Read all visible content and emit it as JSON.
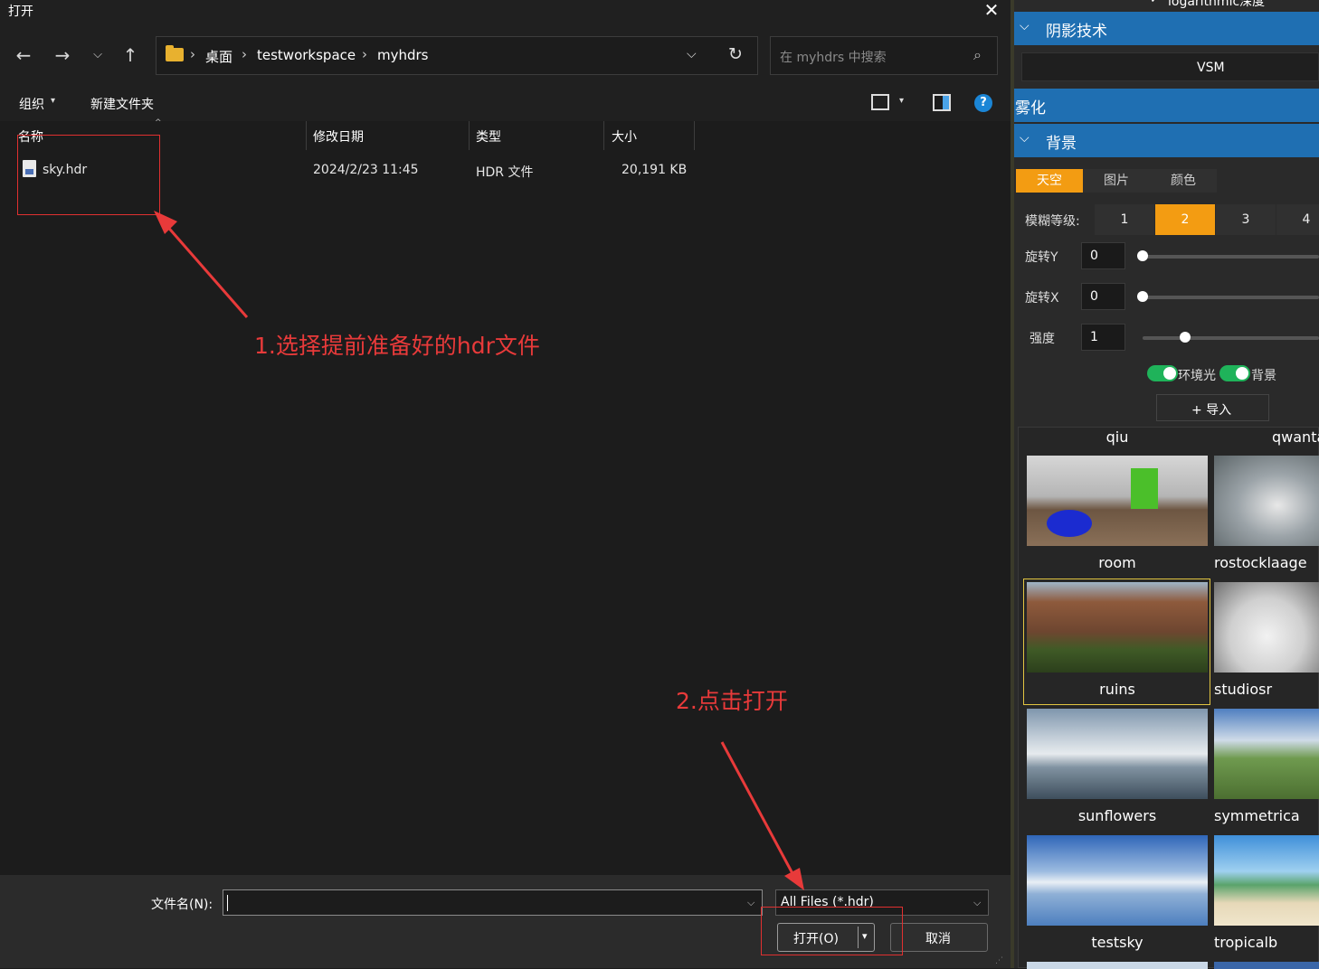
{
  "dialog": {
    "title": "打开",
    "breadcrumb": [
      "桌面",
      "testworkspace",
      "myhdrs"
    ],
    "search_placeholder": "在 myhdrs 中搜索",
    "toolbar": {
      "organize": "组织",
      "new_folder": "新建文件夹"
    },
    "columns": {
      "name": "名称",
      "modified": "修改日期",
      "type": "类型",
      "size": "大小"
    },
    "files": [
      {
        "name": "sky.hdr",
        "modified": "2024/2/23 11:45",
        "type": "HDR 文件",
        "size": "20,191 KB"
      }
    ],
    "filename_label": "文件名(N):",
    "filename_value": "",
    "filter": "All Files (*.hdr)",
    "open_label": "打开(O)",
    "cancel_label": "取消"
  },
  "annotations": {
    "step1": "1.选择提前准备好的hdr文件",
    "step2": "2.点击打开",
    "color": "#e83a3a"
  },
  "panel": {
    "top_cut": "logarithmic深度",
    "shadow_section": "阴影技术",
    "shadow_value": "VSM",
    "fog_section": "雾化",
    "background_section": "背景",
    "bg_tabs": [
      "天空",
      "图片",
      "颜色"
    ],
    "bg_tab_active": "天空",
    "blur_label": "模糊等级:",
    "blur_levels": [
      "1",
      "2",
      "3",
      "4"
    ],
    "blur_active": "2",
    "rotate_y_label": "旋转Y",
    "rotate_y_value": "0",
    "rotate_x_label": "旋转X",
    "rotate_x_value": "0",
    "intensity_label": "强度",
    "intensity_value": "1",
    "toggle_env": "环境光",
    "toggle_bg": "背景",
    "import_label": "+ 导入",
    "gallery_labels_top": [
      "qiu",
      "qwanta"
    ],
    "gallery": [
      "room",
      "rostocklaage",
      "ruins",
      "studiosr",
      "sunflowers",
      "symmetrica",
      "testsky",
      "tropicalb"
    ],
    "gallery_selected": "ruins",
    "accent": "#f39c12",
    "section_color": "#1f6fb2"
  }
}
